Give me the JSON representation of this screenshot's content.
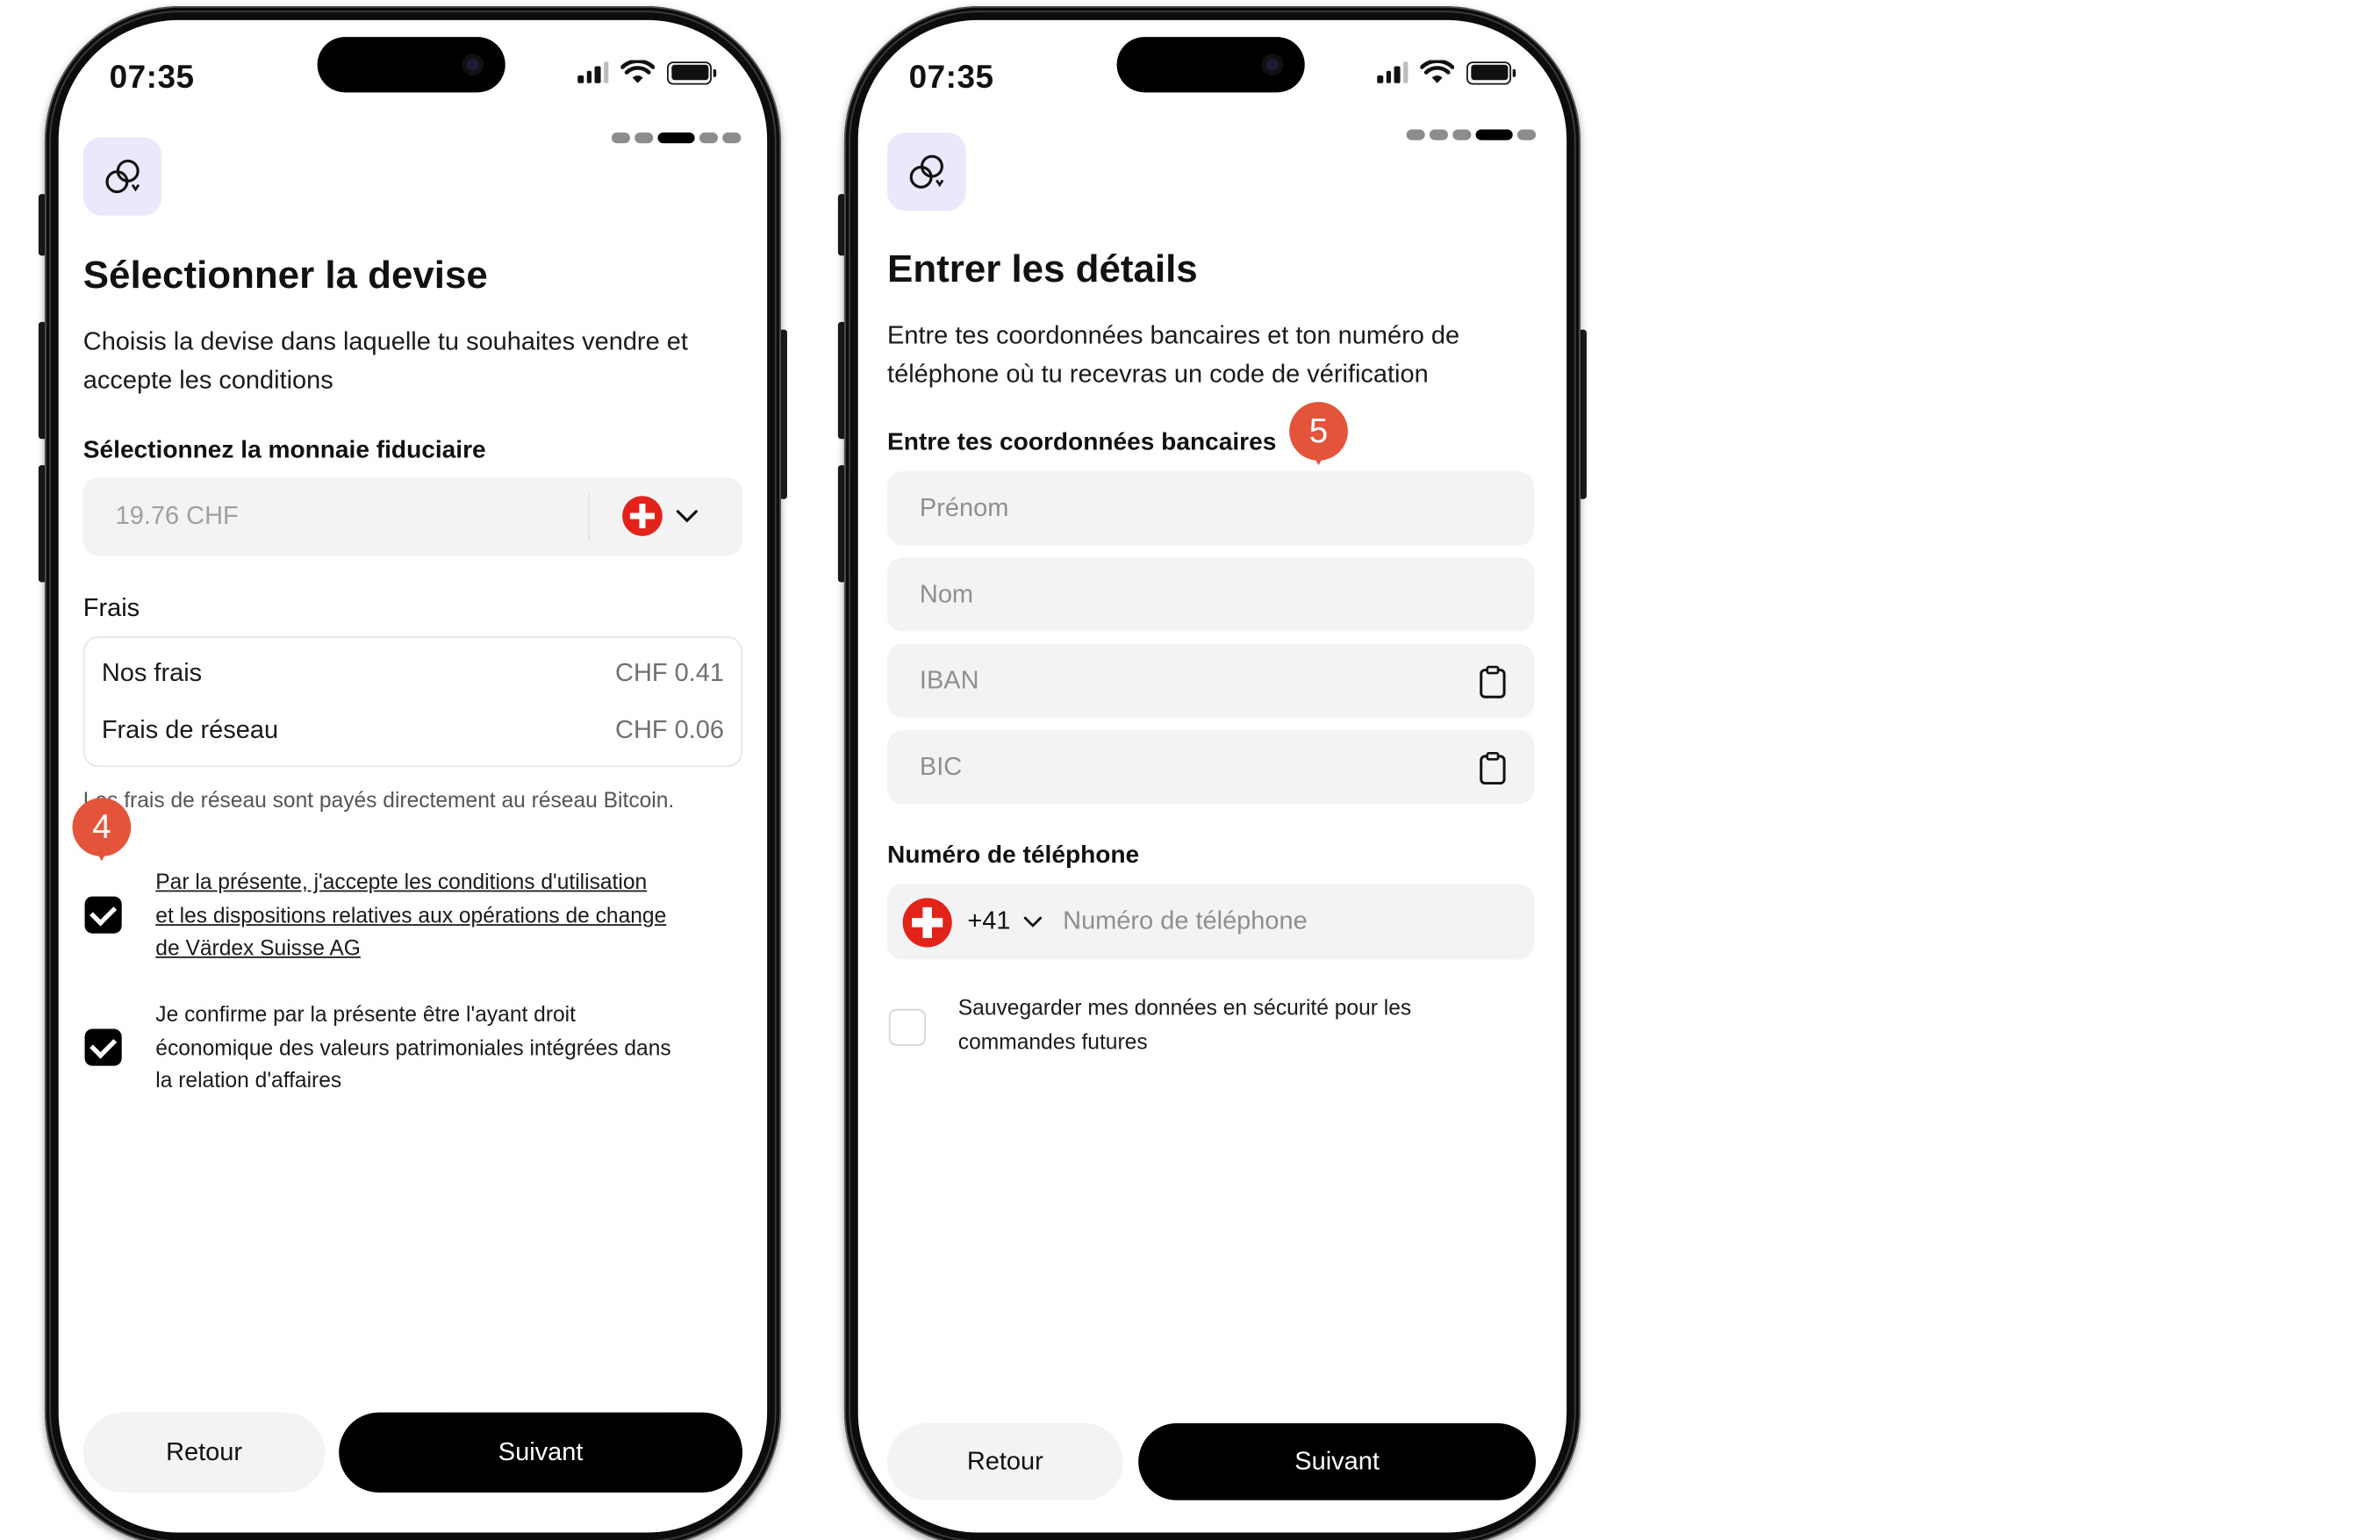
{
  "screen1": {
    "time": "07:35",
    "title": "Sélectionner la devise",
    "subtitle_line1": "Choisis la devise dans laquelle tu souhaites vendre et",
    "subtitle_line2": "accepte les conditions",
    "currency_label": "Sélectionnez la monnaie fiduciaire",
    "currency_amount": "19.76 CHF",
    "fees_label": "Frais",
    "fees": [
      {
        "name": "Nos frais",
        "value": "CHF 0.41"
      },
      {
        "name": "Frais de réseau",
        "value": "CHF 0.06"
      }
    ],
    "network_note": "Les frais de réseau sont payés directement au réseau Bitcoin.",
    "marker": "4",
    "terms_line1": "Par la présente, j'accepte les conditions d'utilisation",
    "terms_line2": "et les dispositions relatives aux opérations de change",
    "terms_line3": "de Värdex Suisse AG",
    "confirm_line1": "Je confirme par la présente être l'ayant droit",
    "confirm_line2": "économique des valeurs patrimoniales intégrées dans",
    "confirm_line3": "la relation d'affaires",
    "back_label": "Retour",
    "next_label": "Suivant"
  },
  "screen2": {
    "time": "07:35",
    "title": "Entrer les détails",
    "subtitle_line1": "Entre tes coordonnées bancaires et ton numéro de",
    "subtitle_line2": "téléphone où tu recevras un code de vérification",
    "bank_label": "Entre tes coordonnées bancaires",
    "marker": "5",
    "first_name_placeholder": "Prénom",
    "last_name_placeholder": "Nom",
    "iban_placeholder": "IBAN",
    "bic_placeholder": "BIC",
    "phone_label": "Numéro de téléphone",
    "country_code": "+41",
    "phone_placeholder": "Numéro de téléphone",
    "save_line1": "Sauvegarder mes données en sécurité pour les",
    "save_line2": "commandes futures",
    "back_label": "Retour",
    "next_label": "Suivant"
  },
  "colors": {
    "accent_marker": "#e4543b",
    "primary_button": "#000000",
    "icon_bg": "#ece8fb",
    "swiss_red": "#e2231a"
  }
}
